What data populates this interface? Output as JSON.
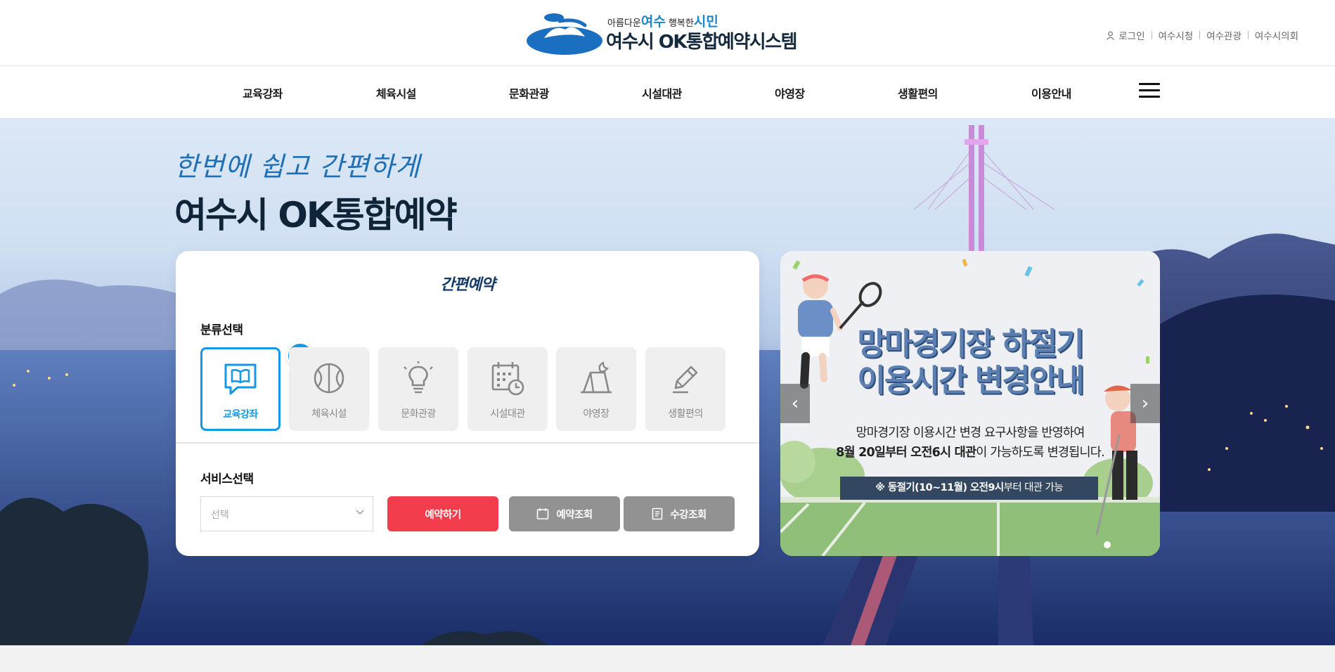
{
  "header": {
    "logo_slogan": {
      "pre": "아름다운",
      "highlight1": "여수",
      "mid": "행복한",
      "highlight2": "시민"
    },
    "logo_title": "여수시 OK통합예약시스템",
    "util_links": [
      {
        "label": "로그인",
        "icon": "person-icon"
      },
      {
        "label": "여수시청"
      },
      {
        "label": "여수관광"
      },
      {
        "label": "여수시의회"
      }
    ]
  },
  "gnb": {
    "items": [
      "교육강좌",
      "체육시설",
      "문화관광",
      "시설대관",
      "야영장",
      "생활편의",
      "이용안내"
    ],
    "menu_icon": "hamburger-icon"
  },
  "hero": {
    "script_text": "한번에 쉽고 간편하게",
    "title": "여수시 OK통합예약"
  },
  "booking": {
    "title": "간편예약",
    "category_label": "분류선택",
    "categories": [
      {
        "label": "교육강좌",
        "icon": "book-chat-icon",
        "active": true
      },
      {
        "label": "체육시설",
        "icon": "ball-icon",
        "active": false
      },
      {
        "label": "문화관광",
        "icon": "lightbulb-icon",
        "active": false
      },
      {
        "label": "시설대관",
        "icon": "calendar-clock-icon",
        "active": false
      },
      {
        "label": "야영장",
        "icon": "tent-moon-icon",
        "active": false
      },
      {
        "label": "생활편의",
        "icon": "pencil-icon",
        "active": false
      }
    ],
    "service_label": "서비스선택",
    "select_placeholder": "선택",
    "buttons": {
      "reserve": "예약하기",
      "reservation_lookup": "예약조회",
      "course_lookup": "수강조회"
    }
  },
  "banner": {
    "headline_line1": "망마경기장 하절기",
    "headline_line2": "이용시간 변경안내",
    "sub_line1": "망마경기장 이용시간 변경 요구사항을 반영하여",
    "sub_line2_bold": "8월 20일부터 오전6시 대관",
    "sub_line2_rest": "이 가능하도록 변경됩니다.",
    "note_bold": "※ 동절기(10~11월) 오전9시",
    "note_rest": "부터 대관 가능",
    "prev": "‹",
    "next": "›"
  },
  "colors": {
    "accent_blue": "#1499e8",
    "reserve_red": "#f43d4c",
    "lookup_gray": "#929292",
    "navy": "#0f2438"
  }
}
